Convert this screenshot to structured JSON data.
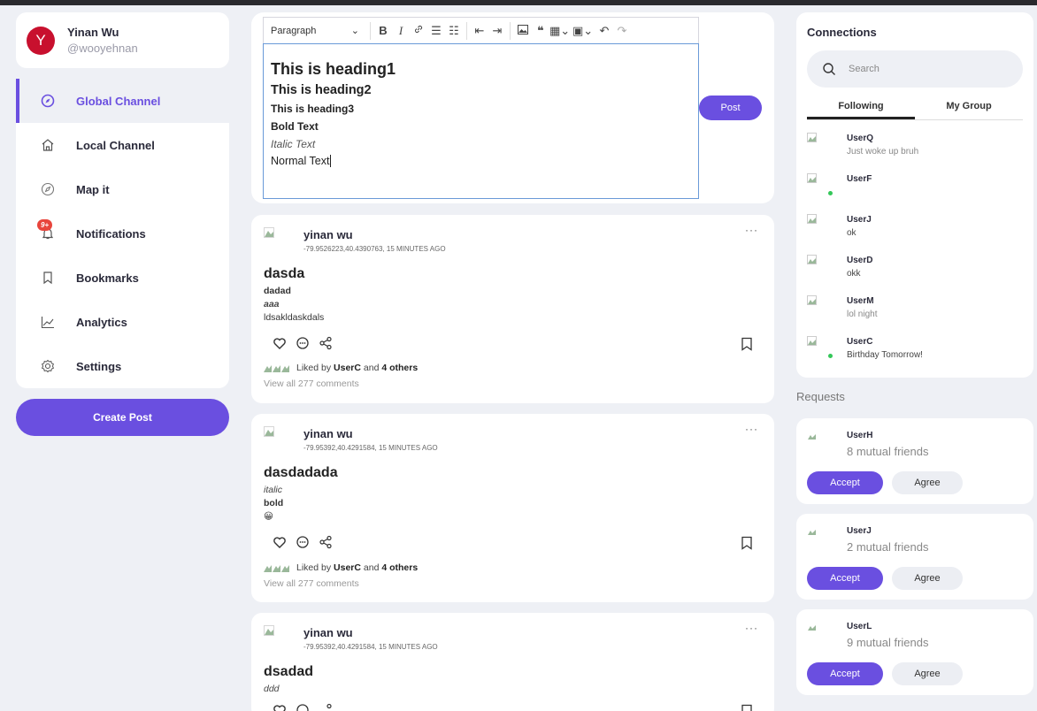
{
  "profile": {
    "initial": "Y",
    "name": "Yinan Wu",
    "handle": "@wooyehnan",
    "avatar_color": "#c8102e"
  },
  "nav": {
    "items": [
      {
        "label": "Global Channel",
        "icon": "compass-icon",
        "active": true
      },
      {
        "label": "Local Channel",
        "icon": "home-icon"
      },
      {
        "label": "Map it",
        "icon": "compass-icon"
      },
      {
        "label": "Notifications",
        "icon": "bell-icon",
        "badge": "9+"
      },
      {
        "label": "Bookmarks",
        "icon": "bookmark-icon"
      },
      {
        "label": "Analytics",
        "icon": "chart-line-icon"
      },
      {
        "label": "Settings",
        "icon": "gear-icon"
      }
    ],
    "create_post": "Create Post"
  },
  "editor": {
    "block_format": "Paragraph",
    "content": {
      "h1": "This is heading1",
      "h2": "This is heading2",
      "h3": "This is heading3",
      "bold": "Bold Text",
      "italic": "Italic Text",
      "normal": "Normal Text"
    },
    "post_label": "Post"
  },
  "posts": [
    {
      "author": "yinan wu",
      "meta": "-79.9526223,40.4390763, 15 MINUTES AGO",
      "title": "dasda",
      "lines": [
        {
          "text": "dadad",
          "style": "b"
        },
        {
          "text": "aaa",
          "style": "bi"
        },
        {
          "text": "ldsakldaskdals",
          "style": ""
        }
      ],
      "liked_prefix": "Liked by",
      "liked_user": "UserC",
      "liked_and": "and",
      "liked_others": "4 others",
      "comments": "View all 277 comments"
    },
    {
      "author": "yinan wu",
      "meta": "-79.95392,40.4291584, 15 MINUTES AGO",
      "title": "dasdadada",
      "lines": [
        {
          "text": "italic",
          "style": "i"
        },
        {
          "text": "bold",
          "style": "b"
        },
        {
          "text": "😀",
          "style": ""
        }
      ],
      "liked_prefix": "Liked by",
      "liked_user": "UserC",
      "liked_and": "and",
      "liked_others": "4 others",
      "comments": "View all 277 comments"
    },
    {
      "author": "yinan wu",
      "meta": "-79.95392,40.4291584, 15 MINUTES AGO",
      "title": "dsadad",
      "lines": [
        {
          "text": "ddd",
          "style": "i"
        }
      ]
    }
  ],
  "connections": {
    "title": "Connections",
    "search_placeholder": "Search",
    "tabs": [
      "Following",
      "My Group"
    ],
    "users": [
      {
        "name": "UserQ",
        "status": "Just woke up bruh",
        "online": false
      },
      {
        "name": "UserF",
        "status": "",
        "online": true
      },
      {
        "name": "UserJ",
        "status": "ok",
        "online": false
      },
      {
        "name": "UserD",
        "status": "okk",
        "online": false
      },
      {
        "name": "UserM",
        "status": "lol night",
        "online": false
      },
      {
        "name": "UserC",
        "status": "Birthday Tomorrow!",
        "online": true
      }
    ]
  },
  "requests": {
    "title": "Requests",
    "items": [
      {
        "name": "UserH",
        "mutual": "8 mutual friends"
      },
      {
        "name": "UserJ",
        "mutual": "2 mutual friends"
      },
      {
        "name": "UserL",
        "mutual": "9 mutual friends"
      }
    ],
    "accept_label": "Accept",
    "agree_label": "Agree"
  },
  "colors": {
    "accent": "#6a4fe0",
    "background": "#eef0f5",
    "online": "#34c759",
    "badge": "#e8453c"
  }
}
